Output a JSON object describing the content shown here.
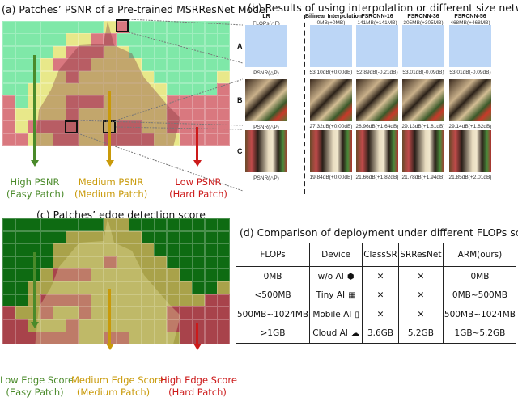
{
  "panel_a": {
    "title": "(a) Patches’ PSNR of a Pre-trained MSRResNet Model",
    "legend": [
      {
        "line1": "High PSNR",
        "line2": "(Easy Patch)",
        "color": "#4a8a2a"
      },
      {
        "line1": "Medium PSNR",
        "line2": "(Medium Patch)",
        "color": "#c99a0a"
      },
      {
        "line1": "Low PSNR",
        "line2": "(Hard Patch)",
        "color": "#cc1a1a"
      }
    ],
    "overlay_colors": {
      "easy": "#7fe8a8",
      "medium": "#e8e88a",
      "hard": "#d9787f"
    }
  },
  "panel_b": {
    "title": "(b) Results of using interpolation or different size networks",
    "columns": [
      {
        "header": "LR",
        "flops": "FLOPs(△F)"
      },
      {
        "header": "Bilinear Interpolation",
        "flops": "0MB(+0MB)"
      },
      {
        "header": "FSRCNN-16",
        "flops": "141MB(+141MB)"
      },
      {
        "header": "FSRCNN-36",
        "flops": "305MB(+305MB)"
      },
      {
        "header": "FSRCNN-56",
        "flops": "468MB(+468MB)"
      }
    ],
    "rows": [
      {
        "label": "A",
        "psnr": [
          "PSNR(△P)",
          "53.10dB(+0.00dB)",
          "52.89dB(-0.21dB)",
          "53.01dB(-0.09dB)",
          "53.01dB(-0.09dB)"
        ]
      },
      {
        "label": "B",
        "psnr": [
          "PSNR(△P)",
          "27.32dB(+0.00dB)",
          "28.96dB(+1.64dB)",
          "29.13dB(+1.81dB)",
          "29.14dB(+1.82dB)"
        ]
      },
      {
        "label": "C",
        "psnr": [
          "PSNR(△P)",
          "19.84dB(+0.00dB)",
          "21.66dB(+1.82dB)",
          "21.78dB(+1.94dB)",
          "21.85dB(+2.01dB)"
        ]
      }
    ]
  },
  "panel_c": {
    "title": "(c) Patches’ edge detection score",
    "legend": [
      {
        "line1": "Low Edge Score",
        "line2": "(Easy Patch)",
        "color": "#4a8a2a"
      },
      {
        "line1": "Medium Edge Score",
        "line2": "(Medium Patch)",
        "color": "#c99a0a"
      },
      {
        "line1": "High Edge Score",
        "line2": "(Hard Patch)",
        "color": "#cc1a1a"
      }
    ],
    "overlay_colors": {
      "easy": "#0e6b12",
      "medium": "#a9a24a",
      "hard": "#a8434b"
    }
  },
  "panel_d": {
    "title": "(d) Comparison of deployment  under different FLOPs scenarios",
    "headers": [
      "FLOPs",
      "Device",
      "ClassSR",
      "SRResNet",
      "ARM(ours)"
    ],
    "rows": [
      {
        "flops": "0MB",
        "device": "w/o AI",
        "icon": "cpu-icon",
        "glyph": "⬢",
        "classsr": "✕",
        "srresnet": "✕",
        "arm": "0MB"
      },
      {
        "flops": "<500MB",
        "device": "Tiny AI",
        "icon": "chip-icon",
        "glyph": "▦",
        "classsr": "✕",
        "srresnet": "✕",
        "arm": "0MB~500MB"
      },
      {
        "flops": "500MB~1024MB",
        "device": "Mobile AI",
        "icon": "phone-icon",
        "glyph": "▯",
        "classsr": "✕",
        "srresnet": "✕",
        "arm": "500MB~1024MB"
      },
      {
        "flops": ">1GB",
        "device": "Cloud AI",
        "icon": "cloud-server-icon",
        "glyph": "☁",
        "classsr": "3.6GB",
        "srresnet": "5.2GB",
        "arm": "1GB~5.2GB"
      }
    ]
  }
}
